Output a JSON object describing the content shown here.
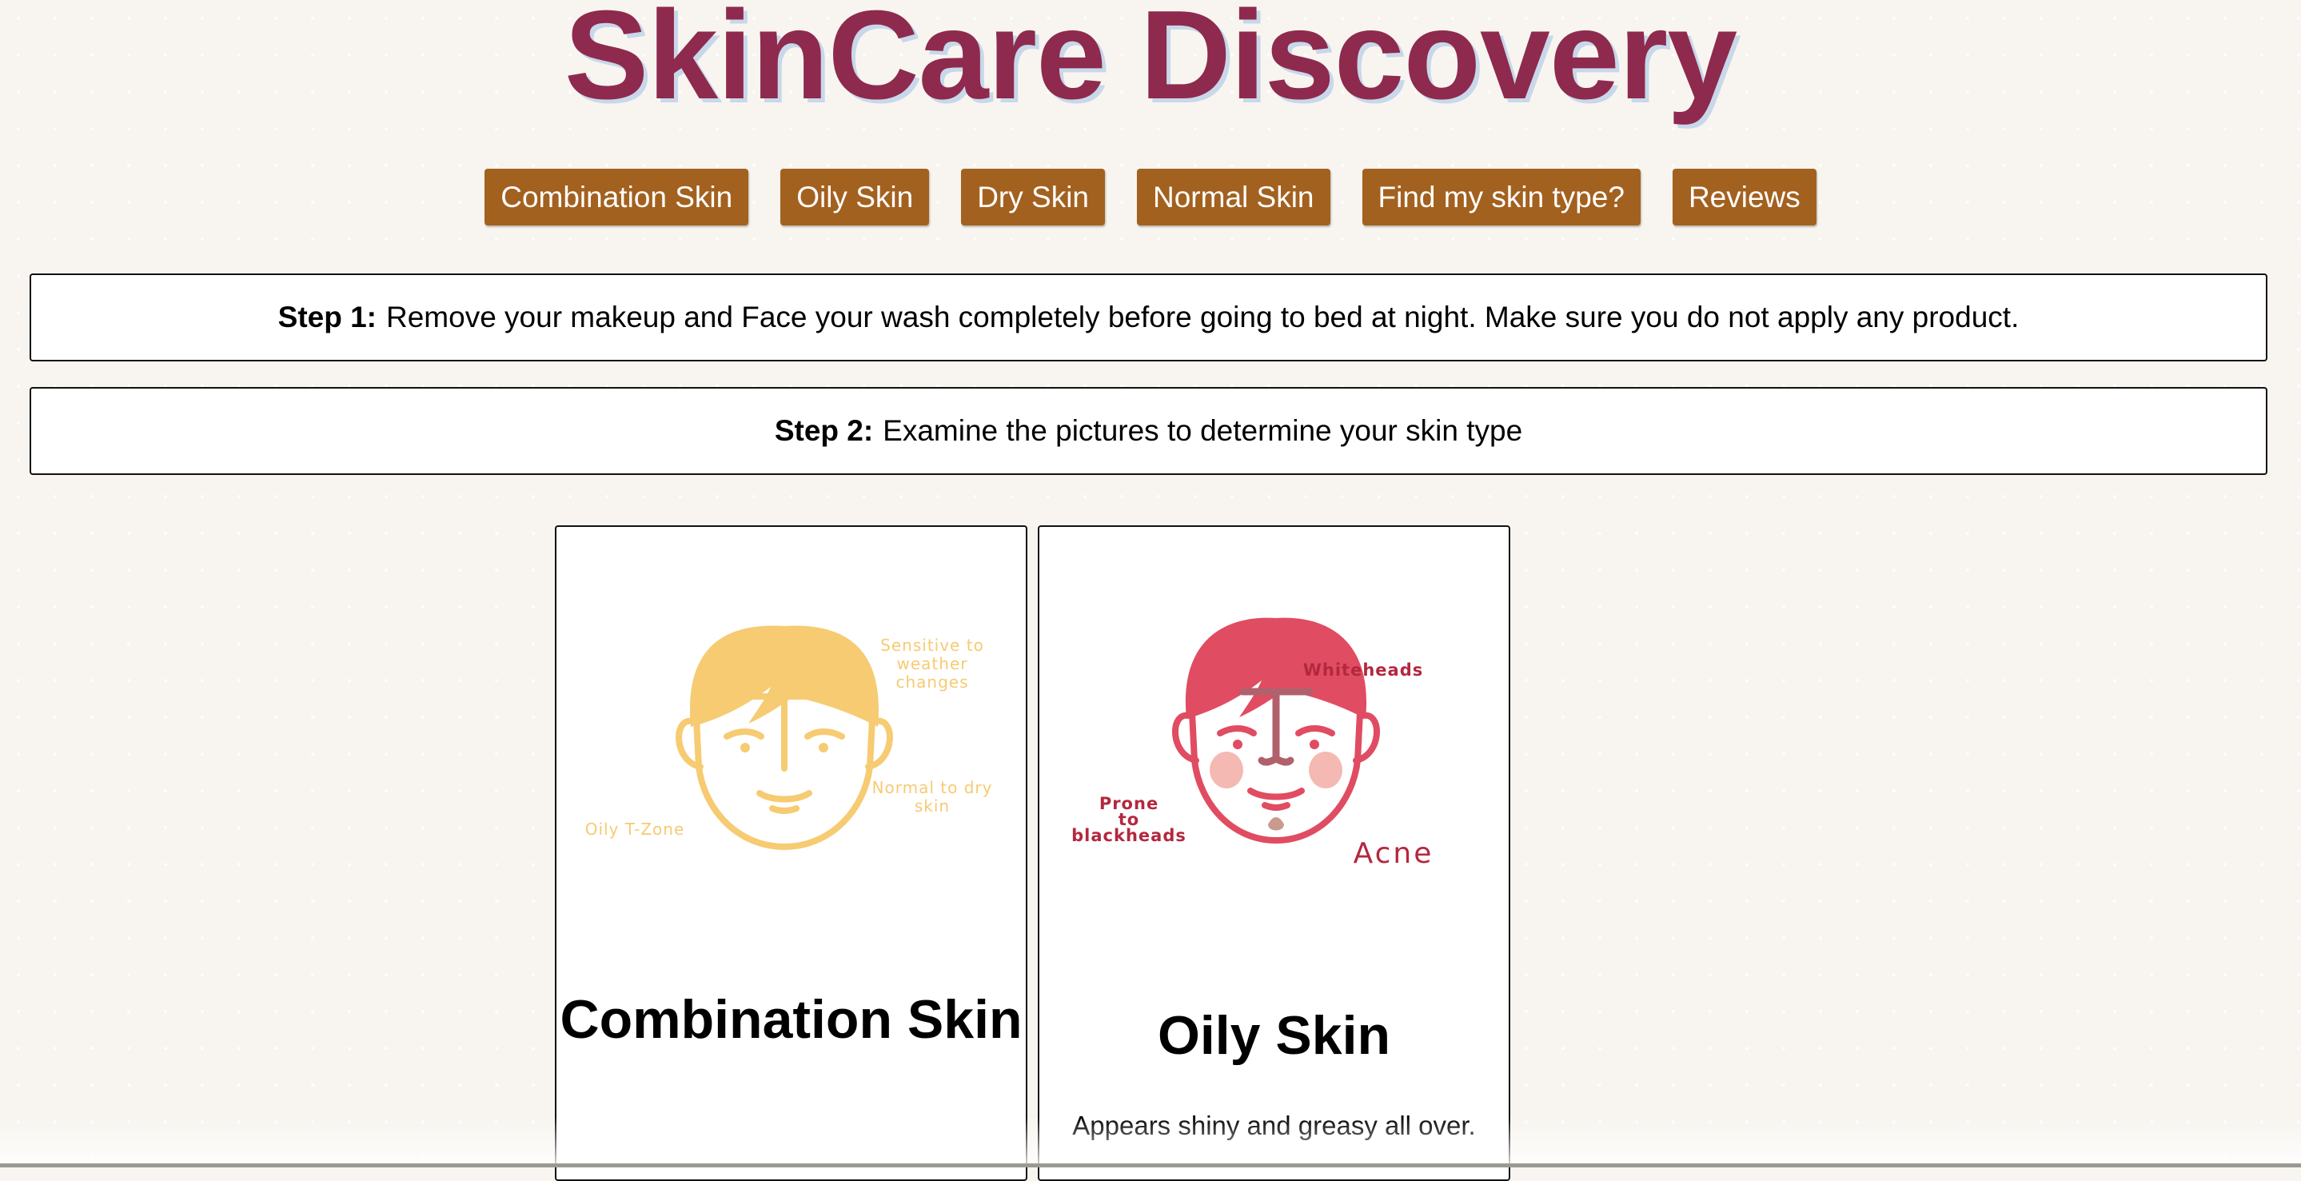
{
  "header": {
    "title": "SkinCare Discovery"
  },
  "nav": {
    "items": [
      {
        "label": "Combination Skin"
      },
      {
        "label": "Oily Skin"
      },
      {
        "label": "Dry Skin"
      },
      {
        "label": "Normal Skin"
      },
      {
        "label": "Find my skin type?"
      },
      {
        "label": "Reviews"
      }
    ]
  },
  "steps": [
    {
      "label": "Step 1:",
      "text": "Remove your makeup and Face your wash completely before going to bed at night. Make sure you do not apply any product."
    },
    {
      "label": "Step 2:",
      "text": "Examine the pictures to determine your skin type"
    }
  ],
  "cards": [
    {
      "title": "Combination Skin",
      "image_labels": {
        "tzone": "Oily T-Zone",
        "sensitive_line1": "Sensitive to",
        "sensitive_line2": "weather",
        "sensitive_line3": "changes",
        "normal_line1": "Normal to dry",
        "normal_line2": "skin"
      }
    },
    {
      "title": "Oily Skin",
      "description": "Appears shiny and greasy all over.",
      "image_labels": {
        "whiteheads": "Whiteheads",
        "prone_line1": "Prone",
        "prone_line2": "to",
        "prone_line3": "blackheads",
        "acne": "Acne"
      }
    }
  ],
  "colors": {
    "title": "#8e2a4e",
    "title_shadow": "#c8d8ea",
    "nav_button": "#a3611f",
    "combination_face": "#f6cb72",
    "oily_face": "#e04c62",
    "oily_tzone": "#b0616b",
    "oily_cheek": "#f3b9b2",
    "oily_label": "#b3283f"
  }
}
